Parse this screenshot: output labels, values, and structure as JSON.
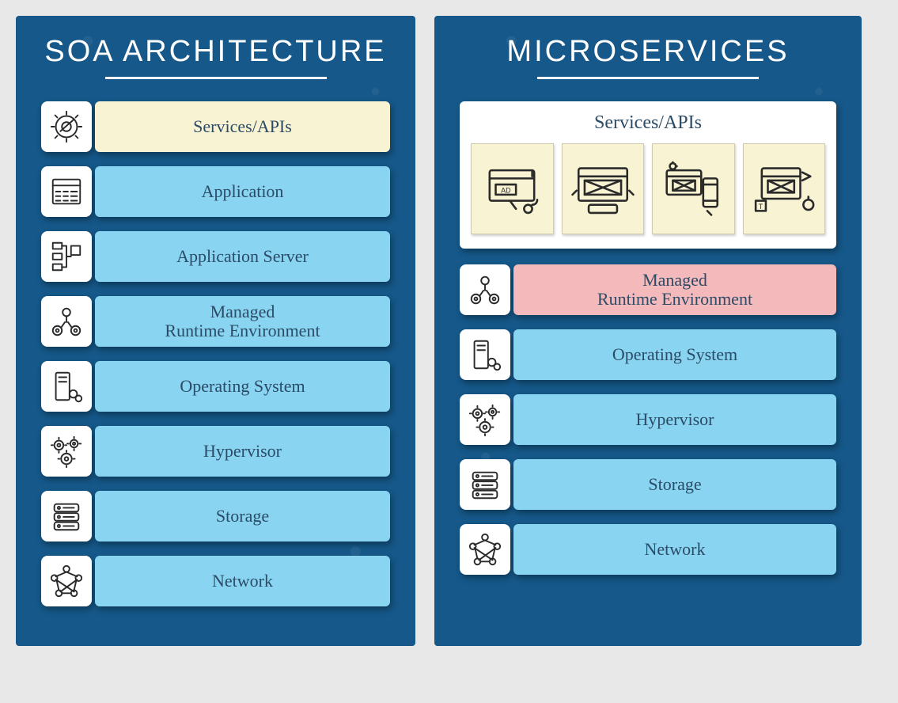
{
  "left": {
    "title": "SOA ARCHITECTURE",
    "layers": [
      {
        "label": "Services/APIs",
        "color": "cream",
        "icon": "gear-wrench-icon"
      },
      {
        "label": "Application",
        "color": "blue",
        "icon": "app-window-icon"
      },
      {
        "label": "Application Server",
        "color": "blue",
        "icon": "server-nodes-icon"
      },
      {
        "label": "Managed\nRuntime Environment",
        "color": "blue",
        "icon": "runtime-icon"
      },
      {
        "label": "Operating System",
        "color": "blue",
        "icon": "os-tower-icon"
      },
      {
        "label": "Hypervisor",
        "color": "blue",
        "icon": "hypervisor-gears-icon"
      },
      {
        "label": "Storage",
        "color": "blue",
        "icon": "storage-drives-icon"
      },
      {
        "label": "Network",
        "color": "blue",
        "icon": "network-graph-icon"
      }
    ]
  },
  "right": {
    "title": "MICROSERVICES",
    "services_header": "Services/APIs",
    "service_tiles": [
      {
        "icon": "tile-ad-icon"
      },
      {
        "icon": "tile-wireframe-icon"
      },
      {
        "icon": "tile-devices-icon"
      },
      {
        "icon": "tile-design-icon"
      }
    ],
    "layers": [
      {
        "label": "Managed\nRuntime Environment",
        "color": "pink",
        "icon": "runtime-icon"
      },
      {
        "label": "Operating System",
        "color": "blue",
        "icon": "os-tower-icon"
      },
      {
        "label": "Hypervisor",
        "color": "blue",
        "icon": "hypervisor-gears-icon"
      },
      {
        "label": "Storage",
        "color": "blue",
        "icon": "storage-drives-icon"
      },
      {
        "label": "Network",
        "color": "blue",
        "icon": "network-graph-icon"
      }
    ]
  },
  "colors": {
    "panel_bg": "#155889",
    "bar_blue": "#89d4f0",
    "bar_cream": "#f8f3d2",
    "bar_pink": "#f4b9bb"
  }
}
